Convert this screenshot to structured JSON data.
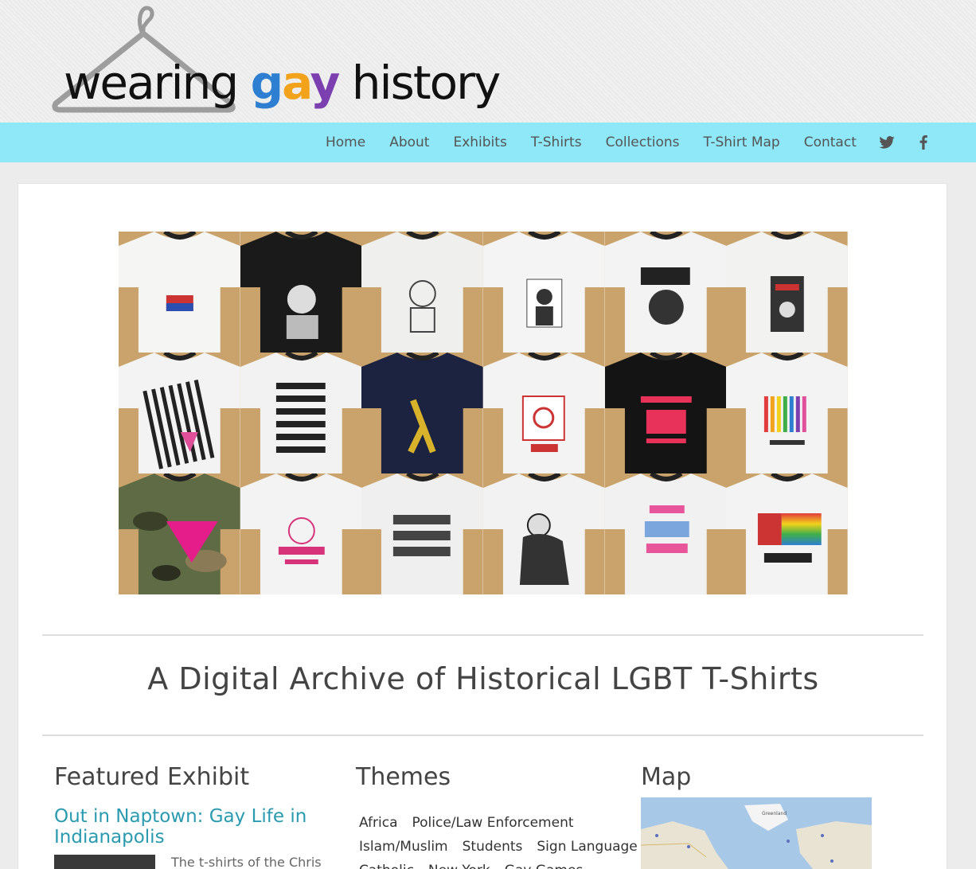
{
  "site": {
    "logo": {
      "word1": "wearing",
      "letters": [
        "g",
        "a",
        "y"
      ],
      "word3": "history",
      "colors": [
        "#e23b3b",
        "#f2a31b",
        "#f3d21b",
        "#3fae49",
        "#2e7fd1",
        "#7b3fb0"
      ]
    },
    "nav": {
      "items": [
        "Home",
        "About",
        "Exhibits",
        "T-Shirts",
        "Collections",
        "T-Shirt Map",
        "Contact"
      ],
      "icons": [
        "twitter-icon",
        "facebook-icon"
      ],
      "bg": "#8ee8f8"
    }
  },
  "gallery": {
    "tiles": [
      {
        "shirt": "#f5f5f3",
        "bg": "#c9a36b",
        "print": "flag"
      },
      {
        "shirt": "#1a1a1a",
        "bg": "#c9a36b",
        "print": "portrait"
      },
      {
        "shirt": "#efefed",
        "bg": "#c9a36b",
        "print": "drawing"
      },
      {
        "shirt": "#f4f4f4",
        "bg": "#c9a36b",
        "print": "milk"
      },
      {
        "shirt": "#f3f3f3",
        "bg": "#c9a36b",
        "print": "bear"
      },
      {
        "shirt": "#f2f2f0",
        "bg": "#c9a36b",
        "print": "poster"
      },
      {
        "shirt": "#f3f3f3",
        "bg": "#c9a36b",
        "print": "stripes"
      },
      {
        "shirt": "#f2f2f2",
        "bg": "#c9a36b",
        "print": "text"
      },
      {
        "shirt": "#1c2340",
        "bg": "#c9a36b",
        "print": "lambda"
      },
      {
        "shirt": "#f3f3f3",
        "bg": "#c9a36b",
        "print": "aids"
      },
      {
        "shirt": "#141414",
        "bg": "#c9a36b",
        "print": "minnesota"
      },
      {
        "shirt": "#f3f3f3",
        "bg": "#c9a36b",
        "print": "rainbow"
      },
      {
        "shirt": "#5e6b44",
        "bg": "#c9a36b",
        "print": "camo"
      },
      {
        "shirt": "#f3f3f3",
        "bg": "#c9a36b",
        "print": "pinkround"
      },
      {
        "shirt": "#efefef",
        "bg": "#c9a36b",
        "print": "queery"
      },
      {
        "shirt": "#f2f2f2",
        "bg": "#c9a36b",
        "print": "stein"
      },
      {
        "shirt": "#f1f1f1",
        "bg": "#c9a36b",
        "print": "pinktour"
      },
      {
        "shirt": "#f3f3f3",
        "bg": "#c9a36b",
        "print": "flagmarch"
      }
    ]
  },
  "tagline": "A Digital Archive of Historical LGBT T-Shirts",
  "featured": {
    "heading": "Featured Exhibit",
    "link": "Out in Naptown: Gay Life in Indianapolis",
    "excerpt": "The t-shirts of the Chris"
  },
  "themes": {
    "heading": "Themes",
    "rows": [
      [
        "Africa",
        "Police/Law Enforcement"
      ],
      [
        "Islam/Muslim",
        "Students",
        "Sign Language"
      ],
      [
        "Catholic",
        "New York",
        "Gay Games"
      ]
    ]
  },
  "map": {
    "heading": "Map",
    "labels": [
      "Greenland"
    ]
  }
}
